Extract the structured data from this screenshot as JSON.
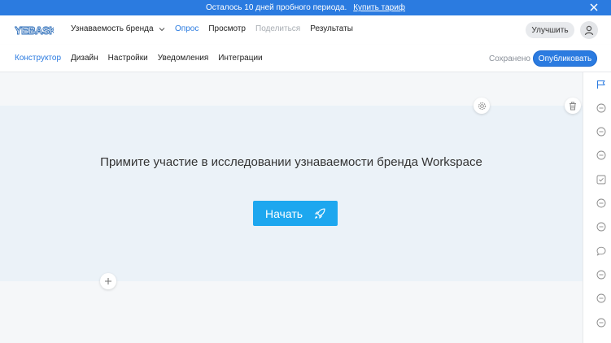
{
  "banner": {
    "message": "Осталось 10 дней пробного периода.",
    "link": "Купить тариф"
  },
  "header": {
    "logo_text": "YEBASK",
    "survey_name": "Узнаваемость бренда",
    "nav": [
      {
        "label": "Опрос",
        "state": "active"
      },
      {
        "label": "Просмотр",
        "state": "normal"
      },
      {
        "label": "Поделиться",
        "state": "disabled"
      },
      {
        "label": "Результаты",
        "state": "normal"
      }
    ],
    "upgrade_label": "Улучшить"
  },
  "subheader": {
    "tabs": [
      {
        "label": "Конструктор",
        "state": "active"
      },
      {
        "label": "Дизайн",
        "state": "normal"
      },
      {
        "label": "Настройки",
        "state": "normal"
      },
      {
        "label": "Уведомления",
        "state": "normal"
      },
      {
        "label": "Интеграции",
        "state": "normal"
      }
    ],
    "saved_label": "Сохранено",
    "publish_label": "Опубликовать"
  },
  "welcome": {
    "title": "Примите участие в исследовании узнаваемости бренда Workspace",
    "start_label": "Начать"
  },
  "right_rail": {
    "items": [
      "flag-icon",
      "circle-plus-icon",
      "circle-plus-icon",
      "circle-plus-icon",
      "checkbox-icon",
      "circle-plus-icon",
      "circle-plus-icon",
      "chat-icon",
      "circle-plus-icon",
      "circle-plus-icon",
      "circle-plus-icon"
    ]
  },
  "colors": {
    "accent": "#2b7be0",
    "start_button": "#1da7ef",
    "welcome_bg": "#ebf2f8"
  }
}
